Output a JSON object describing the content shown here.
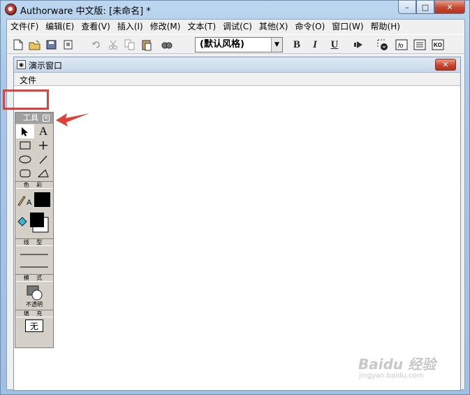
{
  "window": {
    "title": "Authorware 中文版: [未命名] *",
    "controls": {
      "minimize": "–",
      "maximize": "□",
      "close": "✕"
    }
  },
  "menubar": [
    "文件(F)",
    "编辑(E)",
    "查看(V)",
    "插入(I)",
    "修改(M)",
    "文本(T)",
    "调试(C)",
    "其他(X)",
    "命令(O)",
    "窗口(W)",
    "帮助(H)"
  ],
  "toolbar": {
    "style_select": "(默认风格)",
    "bold": "B",
    "italic": "I",
    "underline": "U",
    "func_label": "fo",
    "ko_label": "KO"
  },
  "presentation": {
    "title": "演示窗口",
    "menu": "文件"
  },
  "palette": {
    "title": "工具",
    "text_tool": "A",
    "color_label": "色 彩",
    "color_text_glyph": "A",
    "line_label": "线 型",
    "mode_label": "模 式",
    "mode_value": "不透明",
    "fill_label": "填 充",
    "fill_value": "无"
  },
  "watermark": {
    "brand": "Baidu 经验",
    "url": "jingyan.baidu.com"
  },
  "colors": {
    "highlight": "#e0413a",
    "palette_bg": "#d4d0c8",
    "close_button": "#c9462e"
  }
}
